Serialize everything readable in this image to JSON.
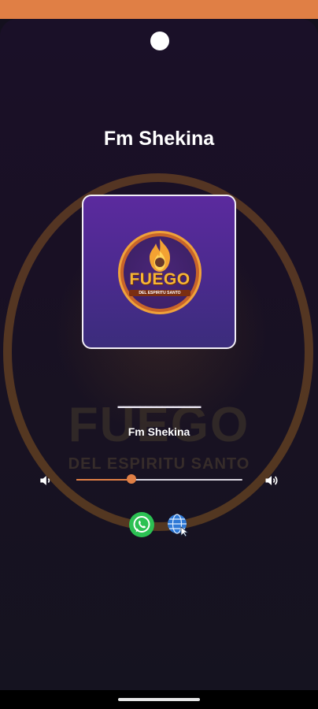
{
  "app": {
    "title": "Fm Shekina",
    "accent_color": "#e07f45"
  },
  "cover": {
    "logo_word": "FUEGO",
    "logo_subtitle": "DEL ESPIRITU SANTO"
  },
  "background_logo": {
    "word": "FUEGO",
    "subtitle": "DEL ESPIRITU SANTO"
  },
  "player": {
    "progress_text": "▬▬▬▬▬▬▬▬▬▬▬▬▬▬▬",
    "station_name": "Fm Shekina",
    "volume_level": 0.33,
    "volume_low_icon": "volume-low-icon",
    "volume_high_icon": "volume-high-icon"
  },
  "actions": {
    "whatsapp_icon": "whatsapp-icon",
    "web_icon": "web-globe-icon"
  }
}
